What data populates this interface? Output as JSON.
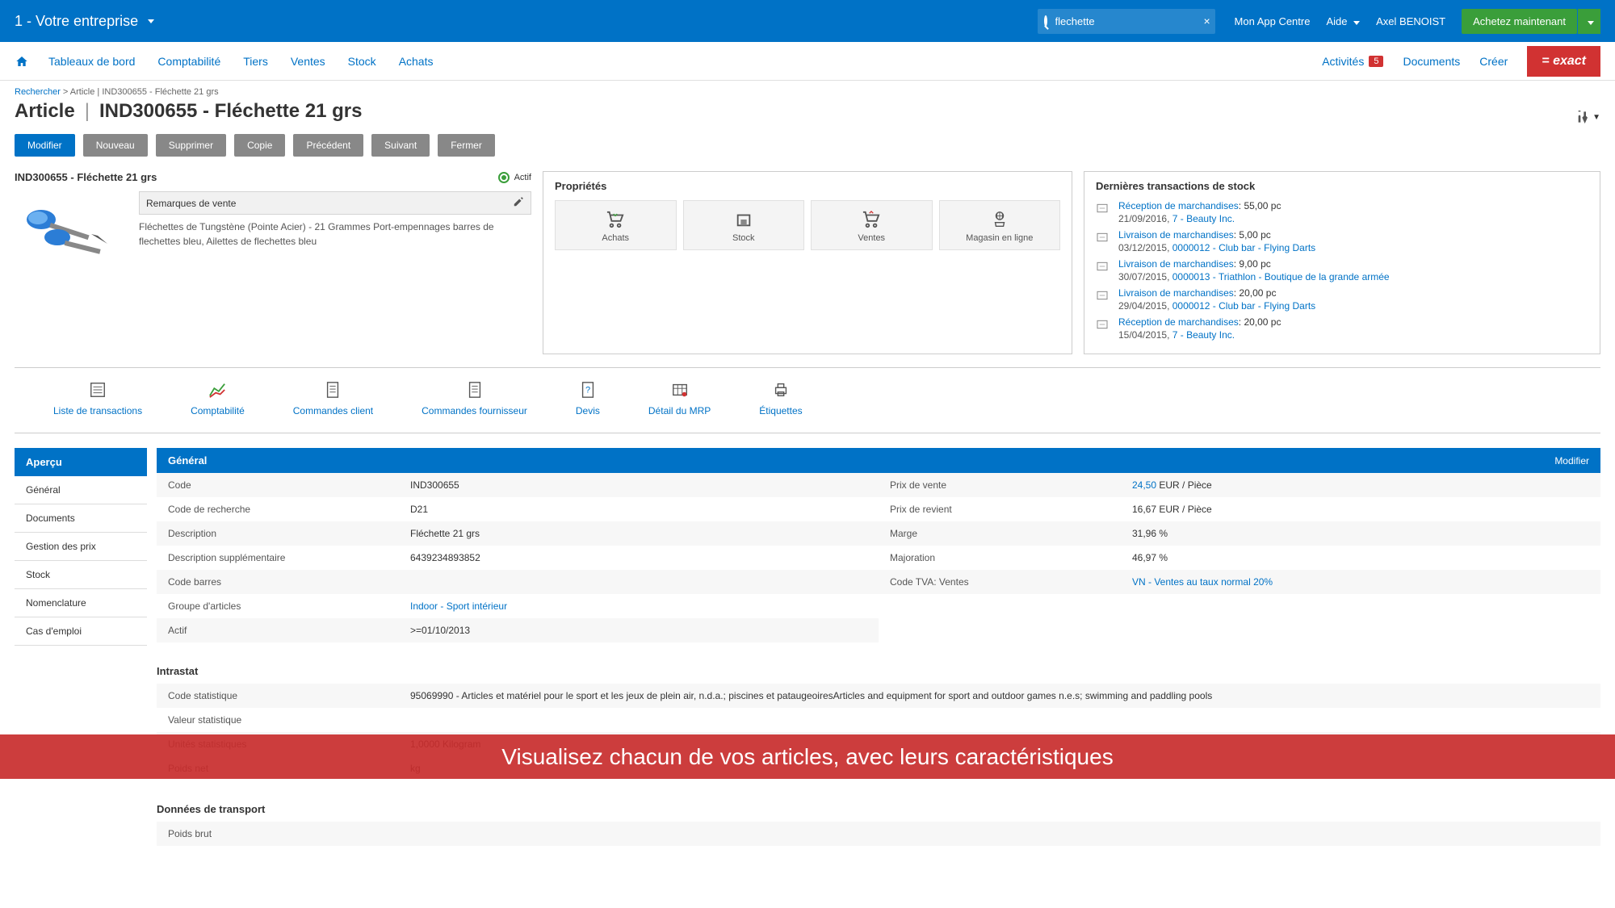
{
  "header": {
    "company": "1 - Votre entreprise",
    "search_value": "flechette",
    "app_centre": "Mon App Centre",
    "help": "Aide",
    "user": "Axel BENOIST",
    "buy_now": "Achetez maintenant"
  },
  "nav": {
    "tabs": [
      "Tableaux de bord",
      "Comptabilité",
      "Tiers",
      "Ventes",
      "Stock",
      "Achats"
    ],
    "activities": "Activités",
    "activities_count": "5",
    "documents": "Documents",
    "create": "Créer",
    "logo": "= exact"
  },
  "breadcrumb": {
    "search": "Rechercher",
    "trail": " > Article | IND300655 - Fléchette 21 grs"
  },
  "title": {
    "type": "Article",
    "name": "IND300655 - Fléchette 21 grs"
  },
  "buttons": {
    "modify": "Modifier",
    "new": "Nouveau",
    "delete": "Supprimer",
    "copy": "Copie",
    "prev": "Précédent",
    "next": "Suivant",
    "close": "Fermer"
  },
  "item": {
    "title": "IND300655 - Fléchette 21 grs",
    "status": "Actif",
    "remarks_label": "Remarques de vente",
    "description": "Fléchettes de Tungstène (Pointe Acier) - 21 Grammes Port-empennages barres de flechettes bleu, Ailettes de flechettes bleu"
  },
  "properties": {
    "heading": "Propriétés",
    "tiles": [
      "Achats",
      "Stock",
      "Ventes",
      "Magasin en ligne"
    ]
  },
  "transactions": {
    "heading": "Dernières transactions de stock",
    "items": [
      {
        "type": "Réception de marchandises",
        "qty": "55,00 pc",
        "date": "21/09/2016",
        "link": "7 - Beauty Inc."
      },
      {
        "type": "Livraison de marchandises",
        "qty": "5,00 pc",
        "date": "03/12/2015",
        "link": "0000012 - Club bar - Flying Darts"
      },
      {
        "type": "Livraison de marchandises",
        "qty": "9,00 pc",
        "date": "30/07/2015",
        "link": "0000013 - Triathlon - Boutique de la grande armée"
      },
      {
        "type": "Livraison de marchandises",
        "qty": "20,00 pc",
        "date": "29/04/2015",
        "link": "0000012 - Club bar - Flying Darts"
      },
      {
        "type": "Réception de marchandises",
        "qty": "20,00 pc",
        "date": "15/04/2015",
        "link": "7 - Beauty Inc."
      }
    ]
  },
  "icon_actions": [
    "Liste de transactions",
    "Comptabilité",
    "Commandes client",
    "Commandes fournisseur",
    "Devis",
    "Détail du MRP",
    "Étiquettes"
  ],
  "sidebar": {
    "header": "Aperçu",
    "items": [
      "Général",
      "Documents",
      "Gestion des prix",
      "Stock",
      "Nomenclature",
      "Cas d'emploi"
    ]
  },
  "general": {
    "heading": "Général",
    "modify": "Modifier",
    "left": [
      {
        "label": "Code",
        "value": "IND300655"
      },
      {
        "label": "Code de recherche",
        "value": "D21"
      },
      {
        "label": "Description",
        "value": "Fléchette 21 grs"
      },
      {
        "label": "Description supplémentaire",
        "value": "6439234893852"
      },
      {
        "label": "Code barres",
        "value": ""
      },
      {
        "label": "Groupe d'articles",
        "value": "Indoor - Sport intérieur",
        "islink": true
      },
      {
        "label": "Actif",
        "value": ">=01/10/2013"
      }
    ],
    "right": [
      {
        "label": "Prix de vente",
        "value_link": "24,50",
        "value_suffix": " EUR / Pièce"
      },
      {
        "label": "Prix de revient",
        "value": "16,67 EUR / Pièce"
      },
      {
        "label": "Marge",
        "value": "31,96 %"
      },
      {
        "label": "Majoration",
        "value": "46,97 %"
      },
      {
        "label": "Code TVA: Ventes",
        "value": "VN - Ventes au taux normal 20%",
        "islink": true
      }
    ]
  },
  "intrastat": {
    "heading": "Intrastat",
    "rows": [
      {
        "label": "Code statistique",
        "value": "95069990 - Articles et matériel pour le sport et les jeux de plein air, n.d.a.; piscines et pataugeoiresArticles and equipment for sport and outdoor games n.e.s; swimming and paddling pools"
      },
      {
        "label": "Valeur statistique",
        "value": ""
      },
      {
        "label": "Unités statistiques",
        "value": "1,0000 Kilogram"
      },
      {
        "label": "Poids net",
        "value": "kg"
      }
    ]
  },
  "transport": {
    "heading": "Données de transport",
    "rows": [
      {
        "label": "Poids brut",
        "value": ""
      }
    ]
  },
  "overlay": "Visualisez chacun de vos articles, avec leurs caractéristiques"
}
